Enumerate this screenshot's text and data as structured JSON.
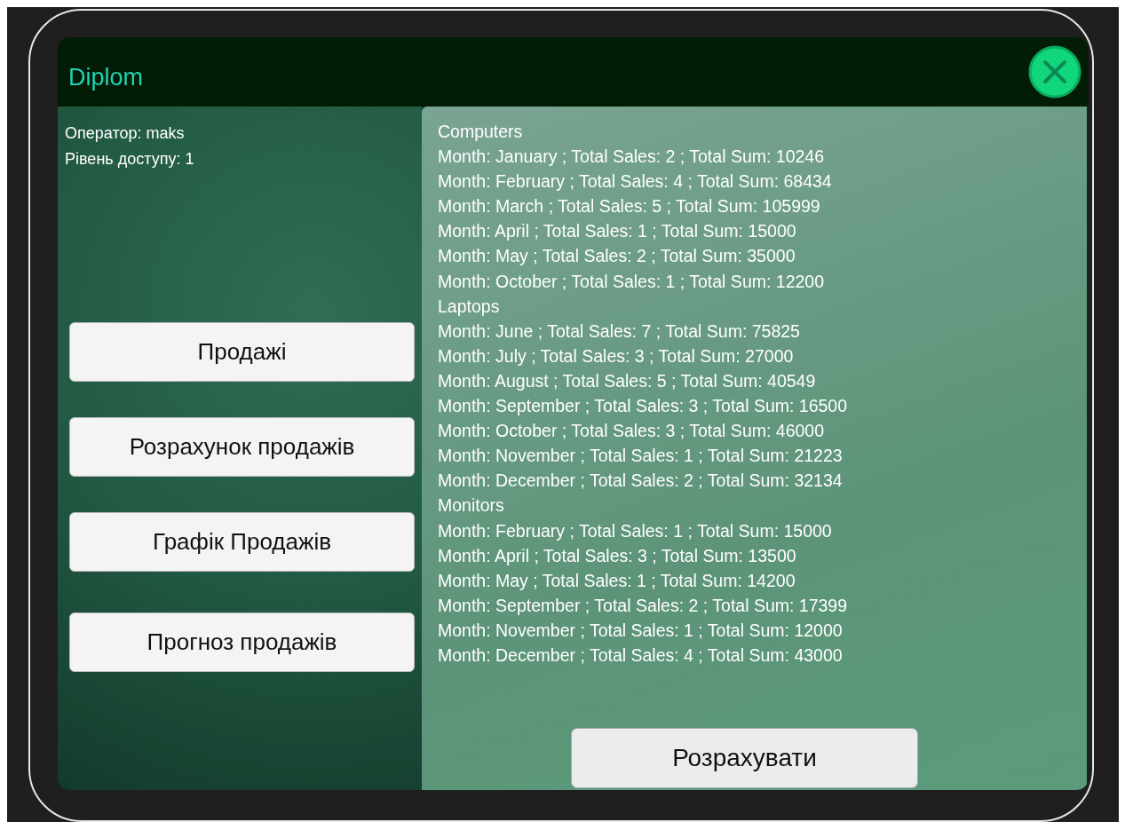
{
  "window": {
    "title": "Diplom"
  },
  "operator": [
    "Оператор: maks",
    "Рівень доступу: 1"
  ],
  "menu": [
    "Продажі",
    "Розрахунок продажів",
    "Графік Продажів",
    "Прогноз продажів"
  ],
  "report": [
    "Computers",
    "Month: January ; Total Sales: 2 ; Total Sum: 10246",
    "Month: February ; Total Sales: 4 ; Total Sum: 68434",
    "Month: March ; Total Sales: 5 ; Total Sum: 105999",
    "Month: April ; Total Sales: 1 ; Total Sum: 15000",
    "Month: May ; Total Sales: 2 ; Total Sum: 35000",
    "Month: October ; Total Sales: 1 ; Total Sum: 12200",
    "Laptops",
    "Month: June ; Total Sales: 7 ; Total Sum: 75825",
    "Month: July ; Total Sales: 3 ; Total Sum: 27000",
    "Month: August ; Total Sales: 5 ; Total Sum: 40549",
    "Month: September ; Total Sales: 3 ; Total Sum: 16500",
    "Month: October ; Total Sales: 3 ; Total Sum: 46000",
    "Month: November ; Total Sales: 1 ; Total Sum: 21223",
    "Month: December ; Total Sales: 2 ; Total Sum: 32134",
    "Monitors",
    "Month: February ; Total Sales: 1 ; Total Sum: 15000",
    "Month: April ; Total Sales: 3 ; Total Sum: 13500",
    "Month: May ; Total Sales: 1 ; Total Sum: 14200",
    "Month: September ; Total Sales: 2 ; Total Sum: 17399",
    "Month: November ; Total Sales: 1 ; Total Sum: 12000",
    "Month: December ; Total Sales: 4 ; Total Sum: 43000"
  ],
  "calculate_button": "Розрахувати"
}
